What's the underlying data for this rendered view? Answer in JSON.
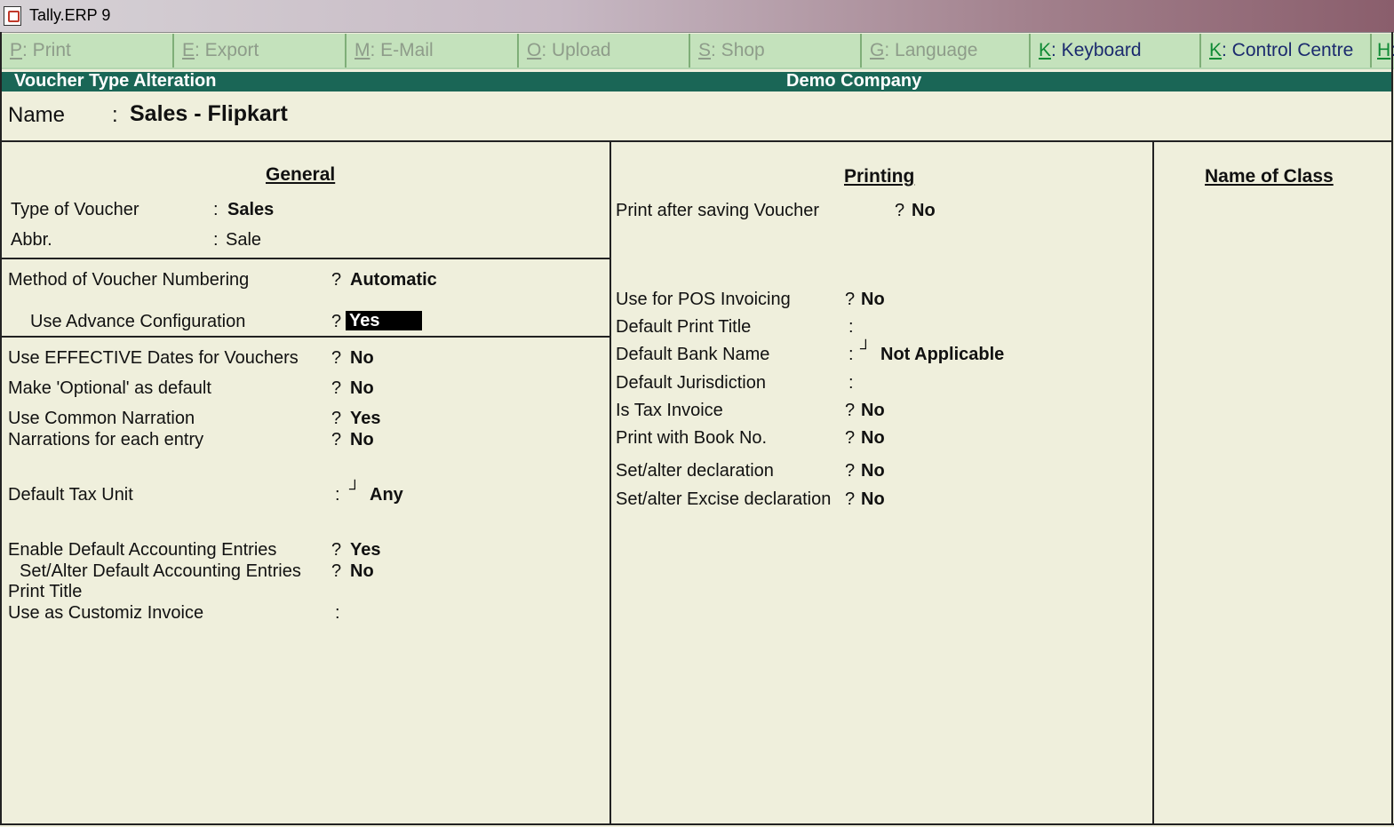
{
  "window": {
    "title": "Tally.ERP 9",
    "icon": "tally-icon"
  },
  "toolbar": [
    {
      "key": "P",
      "label": ": Print",
      "enabled": false
    },
    {
      "key": "E",
      "label": ": Export",
      "enabled": false
    },
    {
      "key": "M",
      "label": ": E-Mail",
      "enabled": false
    },
    {
      "key": "O",
      "label": ": Upload",
      "enabled": false
    },
    {
      "key": "S",
      "label": ": Shop",
      "enabled": false
    },
    {
      "key": "G",
      "label": ": Language",
      "enabled": false
    },
    {
      "key": "K",
      "label": ": Keyboard",
      "enabled": true
    },
    {
      "key": "K",
      "label": ": Control Centre",
      "enabled": true
    },
    {
      "key": "H",
      "label": ":",
      "enabled": true
    }
  ],
  "header": {
    "screen_title": "Voucher Type Alteration",
    "company": "Demo Company"
  },
  "name": {
    "label": "Name",
    "sep": ":",
    "value": "Sales - Flipkart"
  },
  "general": {
    "heading": "General",
    "type_of_voucher": {
      "label": "Type of Voucher",
      "sep": ":",
      "value": "Sales"
    },
    "abbr": {
      "label": "Abbr.",
      "sep": ":",
      "value": "Sale"
    },
    "method_numbering": {
      "label": "Method of Voucher Numbering",
      "sep": "?",
      "value": "Automatic"
    },
    "advance_config": {
      "label": "Use Advance Configuration",
      "sep": "?",
      "value": "Yes"
    },
    "effective_dates": {
      "label": "Use EFFECTIVE Dates for Vouchers",
      "sep": "?",
      "value": "No"
    },
    "optional_default": {
      "label": "Make 'Optional' as default",
      "sep": "?",
      "value": "No"
    },
    "common_narration": {
      "label": "Use Common Narration",
      "sep": "?",
      "value": "Yes"
    },
    "narration_each": {
      "label": "Narrations for each entry",
      "sep": "?",
      "value": "No"
    },
    "default_tax_unit": {
      "label": "Default Tax Unit",
      "sep": ":",
      "marker": "┘",
      "value": "Any"
    },
    "enable_default_acc": {
      "label": "Enable Default Accounting Entries",
      "sep": "?",
      "value": "Yes"
    },
    "set_alter_default_acc": {
      "label": "Set/Alter Default Accounting Entries",
      "sep": "?",
      "value": "No"
    },
    "print_title": {
      "label": "Print Title"
    },
    "customiz_invoice": {
      "label": "Use as Customiz Invoice",
      "sep": ":"
    }
  },
  "printing": {
    "heading": "Printing",
    "print_after_saving": {
      "label": "Print after saving Voucher",
      "sep": "?",
      "value": "No"
    },
    "pos_invoicing": {
      "label": "Use for POS Invoicing",
      "sep": "?",
      "value": "No"
    },
    "default_print_title": {
      "label": "Default Print Title",
      "sep": ":"
    },
    "default_bank_name": {
      "label": "Default Bank Name",
      "sep": ":",
      "marker": "┘",
      "value": "Not Applicable"
    },
    "default_jurisdiction": {
      "label": "Default Jurisdiction",
      "sep": ":"
    },
    "is_tax_invoice": {
      "label": "Is Tax Invoice",
      "sep": "?",
      "value": "No"
    },
    "print_book_no": {
      "label": "Print with Book No.",
      "sep": "?",
      "value": "No"
    },
    "set_alter_declaration": {
      "label": "Set/alter declaration",
      "sep": "?",
      "value": "No"
    },
    "set_alter_excise": {
      "label": "Set/alter Excise declaration",
      "sep": "?",
      "value": "No"
    }
  },
  "name_of_class": {
    "heading": "Name of Class"
  }
}
